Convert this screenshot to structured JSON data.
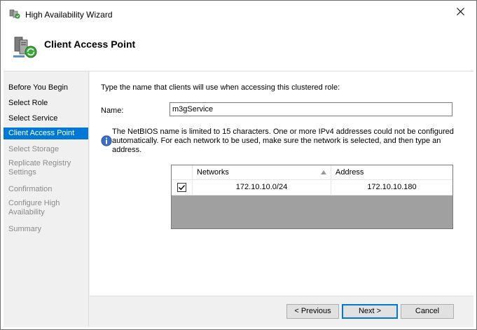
{
  "window": {
    "title": "High Availability Wizard"
  },
  "header": {
    "title": "Client Access Point"
  },
  "nav": {
    "items": [
      {
        "label": "Before You Begin",
        "state": "enabled"
      },
      {
        "label": "Select Role",
        "state": "enabled"
      },
      {
        "label": "Select Service",
        "state": "enabled"
      },
      {
        "label": "Client Access Point",
        "state": "active"
      },
      {
        "label": "Select Storage",
        "state": "disabled"
      },
      {
        "label": "Replicate Registry Settings",
        "state": "disabled"
      },
      {
        "label": "Confirmation",
        "state": "disabled"
      },
      {
        "label": "Configure High Availability",
        "state": "disabled"
      },
      {
        "label": "Summary",
        "state": "disabled"
      }
    ]
  },
  "main": {
    "instruction": "Type the name that clients will use when accessing this clustered role:",
    "name_label": "Name:",
    "name_value": "m3gService",
    "info_text": "The NetBIOS name is limited to 15 characters.  One or more IPv4 addresses could not be configured automatically.  For each network to be used, make sure the network is selected, and then type an address.",
    "grid": {
      "columns": [
        "Networks",
        "Address"
      ],
      "rows": [
        {
          "checked": true,
          "network": "172.10.10.0/24",
          "address": "172.10.10.180"
        }
      ]
    }
  },
  "footer": {
    "previous_label": "< Previous",
    "next_label": "Next >",
    "cancel_label": "Cancel"
  },
  "colors": {
    "accent": "#0078d7",
    "disabled_text": "#8a8a8a",
    "grid_empty": "#a0a0a0"
  }
}
